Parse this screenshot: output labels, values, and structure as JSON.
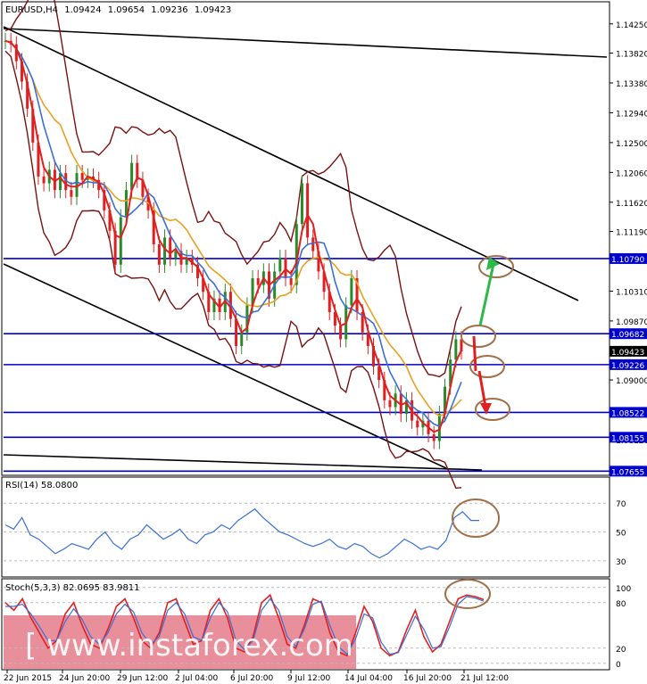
{
  "chart_data": [
    {
      "type": "line",
      "panel": "price",
      "header": {
        "symbol": "EURUSD,H4",
        "open": "1.09424",
        "high": "1.09654",
        "low": "1.09236",
        "close": "1.09423"
      },
      "y_ticks": [
        "1.14250",
        "1.13820",
        "1.13380",
        "1.12940",
        "1.12500",
        "1.12060",
        "1.11620",
        "1.11190",
        "1.10310",
        "1.09870",
        "1.09000",
        "1.08120"
      ],
      "ylim": [
        1.0762,
        1.1455
      ],
      "horizontal_levels": [
        {
          "value": 1.1079,
          "label": "1.10790",
          "color": "#0000cc"
        },
        {
          "value": 1.09682,
          "label": "1.09682",
          "color": "#0000cc"
        },
        {
          "value": 1.09226,
          "label": "1.09226",
          "color": "#0000cc"
        },
        {
          "value": 1.08522,
          "label": "1.08522",
          "color": "#0000cc"
        },
        {
          "value": 1.08155,
          "label": "1.08155",
          "color": "#0000cc"
        },
        {
          "value": 1.07655,
          "label": "1.07655",
          "color": "#0000cc"
        }
      ],
      "current_price": {
        "value": 1.09423,
        "label": "1.09423"
      },
      "price_path": [
        1.14,
        1.1395,
        1.137,
        1.134,
        1.13,
        1.125,
        1.12,
        1.119,
        1.121,
        1.118,
        1.1205,
        1.118,
        1.117,
        1.1205,
        1.1195,
        1.12,
        1.1195,
        1.118,
        1.115,
        1.112,
        1.107,
        1.114,
        1.118,
        1.122,
        1.1195,
        1.117,
        1.115,
        1.11,
        1.107,
        1.111,
        1.108,
        1.109,
        1.107,
        1.108,
        1.107,
        1.105,
        1.103,
        1.1,
        1.102,
        1.1,
        1.103,
        1.099,
        1.095,
        1.097,
        1.101,
        1.105,
        1.104,
        1.106,
        1.102,
        1.106,
        1.108,
        1.105,
        1.104,
        1.113,
        1.119,
        1.111,
        1.109,
        1.106,
        1.103,
        1.1,
        1.098,
        1.096,
        1.101,
        1.105,
        1.1,
        1.097,
        1.095,
        1.092,
        1.09,
        1.087,
        1.086,
        1.088,
        1.085,
        1.087,
        1.084,
        1.083,
        1.084,
        1.082,
        1.081,
        1.085,
        1.089,
        1.093,
        1.096,
        1.0942
      ],
      "lines": [
        {
          "name": "upper-channel",
          "color": "#000000"
        },
        {
          "name": "lower-channel",
          "color": "#000000"
        },
        {
          "name": "top-resistance",
          "color": "#000000"
        },
        {
          "name": "bottom-support",
          "color": "#000000"
        }
      ],
      "moving_average_colors": [
        "#e8a020",
        "#3a6fd8",
        "#e02020"
      ],
      "bollinger_color": "#7a1010",
      "arrows": [
        {
          "direction": "up",
          "color": "#2db84a"
        },
        {
          "direction": "down",
          "color": "#e02020"
        }
      ],
      "markers_color": "#a0704a"
    },
    {
      "type": "line",
      "panel": "rsi",
      "label": "RSI(14) 58.0800",
      "y_ticks": [
        "70",
        "50",
        "30"
      ],
      "ylim": [
        20,
        85
      ],
      "series": [
        {
          "values": [
            55,
            52,
            60,
            48,
            45,
            40,
            35,
            38,
            42,
            40,
            38,
            45,
            50,
            42,
            38,
            45,
            48,
            55,
            50,
            45,
            48,
            52,
            45,
            42,
            48,
            50,
            55,
            52,
            58,
            62,
            66,
            60,
            55,
            50,
            48,
            45,
            42,
            40,
            42,
            45,
            40,
            38,
            42,
            40,
            35,
            32,
            35,
            40,
            45,
            42,
            38,
            40,
            38,
            44,
            60,
            64,
            58,
            58
          ]
        }
      ],
      "color": "#3a6fd8"
    },
    {
      "type": "line",
      "panel": "stochastic",
      "label": "Stoch(5,3,3) 82.0695 83.9811",
      "y_ticks": [
        "100",
        "80",
        "20",
        "0"
      ],
      "ylim": [
        -5,
        108
      ],
      "series": [
        {
          "values": [
            80,
            70,
            85,
            60,
            40,
            20,
            30,
            65,
            80,
            50,
            25,
            20,
            45,
            75,
            85,
            60,
            30,
            20,
            40,
            80,
            85,
            55,
            25,
            30,
            70,
            85,
            60,
            20,
            15,
            35,
            80,
            90,
            60,
            25,
            20,
            50,
            85,
            80,
            40,
            15,
            10,
            40,
            75,
            55,
            20,
            10,
            15,
            45,
            70,
            35,
            15,
            25,
            55,
            85,
            90,
            88,
            84
          ]
        },
        {
          "values": [
            75,
            75,
            78,
            65,
            48,
            30,
            30,
            55,
            72,
            58,
            35,
            25,
            40,
            65,
            78,
            68,
            40,
            25,
            35,
            70,
            80,
            65,
            35,
            30,
            60,
            80,
            68,
            30,
            18,
            30,
            70,
            85,
            70,
            35,
            22,
            45,
            78,
            82,
            50,
            22,
            12,
            32,
            65,
            60,
            28,
            12,
            14,
            38,
            62,
            45,
            20,
            22,
            48,
            78,
            88,
            86,
            82
          ]
        }
      ],
      "colors": [
        "#e02020",
        "#3a6fd8"
      ],
      "overlay_color": "#e06a7a"
    }
  ],
  "x_labels": [
    "22 Jun 2015",
    "24 Jun 20:00",
    "29 Jun 12:00",
    "2 Jul 04:00",
    "6 Jul 20:00",
    "9 Jul 12:00",
    "14 Jul 04:00",
    "16 Jul 20:00",
    "21 Jul 12:00"
  ],
  "watermark": "[ www.instaforex.com ]"
}
